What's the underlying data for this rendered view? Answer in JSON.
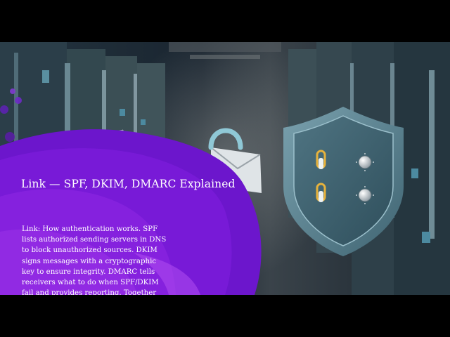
{
  "slide": {
    "title": "Link — SPF, DKIM, DMARC Explained",
    "body": "Link: How authentication works. SPF lists authorized sending servers in DNS to block unauthorized sources. DKIM signs messages with a cryptographic key to ensure integrity. DMARC tells receivers what to do when SPF/DKIM fail and provides reporting. Together they provide"
  },
  "illustration": {
    "background": "server-room",
    "icons": [
      "envelope-icon",
      "padlock-icon",
      "shield-icon"
    ]
  },
  "colors": {
    "accent_purple": "#8a1fe0",
    "shield": "#5e8493",
    "letterbox": "#000000"
  }
}
